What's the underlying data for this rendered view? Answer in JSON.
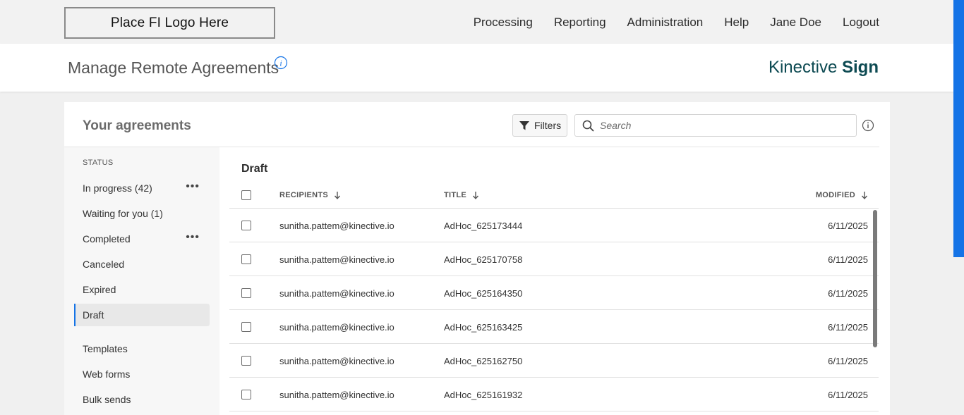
{
  "topbar": {
    "logo_text": "Place FI Logo Here",
    "nav": [
      "Processing",
      "Reporting",
      "Administration",
      "Help",
      "Jane Doe",
      "Logout"
    ]
  },
  "header": {
    "title": "Manage Remote Agreements",
    "brand_light": "Kinective",
    "brand_bold": "Sign"
  },
  "card": {
    "title": "Your agreements",
    "filters_label": "Filters",
    "search_placeholder": "Search"
  },
  "sidebar": {
    "status_heading": "STATUS",
    "items": [
      {
        "label": "In progress (42)",
        "has_menu": true
      },
      {
        "label": "Waiting for you (1)",
        "has_menu": false
      },
      {
        "label": "Completed",
        "has_menu": true
      },
      {
        "label": "Canceled",
        "has_menu": false
      },
      {
        "label": "Expired",
        "has_menu": false
      },
      {
        "label": "Draft",
        "has_menu": false,
        "active": true
      },
      {
        "label": "Templates",
        "has_menu": false
      },
      {
        "label": "Web forms",
        "has_menu": false
      },
      {
        "label": "Bulk sends",
        "has_menu": false
      }
    ]
  },
  "table": {
    "section_title": "Draft",
    "columns": {
      "recipients": "RECIPIENTS",
      "title": "TITLE",
      "modified": "MODIFIED"
    },
    "rows": [
      {
        "recipient": "sunitha.pattem@kinective.io",
        "title": "AdHoc_625173444",
        "modified": "6/11/2025"
      },
      {
        "recipient": "sunitha.pattem@kinective.io",
        "title": "AdHoc_625170758",
        "modified": "6/11/2025"
      },
      {
        "recipient": "sunitha.pattem@kinective.io",
        "title": "AdHoc_625164350",
        "modified": "6/11/2025"
      },
      {
        "recipient": "sunitha.pattem@kinective.io",
        "title": "AdHoc_625163425",
        "modified": "6/11/2025"
      },
      {
        "recipient": "sunitha.pattem@kinective.io",
        "title": "AdHoc_625162750",
        "modified": "6/11/2025"
      },
      {
        "recipient": "sunitha.pattem@kinective.io",
        "title": "AdHoc_625161932",
        "modified": "6/11/2025"
      }
    ]
  },
  "colors": {
    "accent": "#1473e6",
    "brand": "#0d4a52"
  },
  "icons": [
    "info-icon",
    "filter-icon",
    "search-icon",
    "sort-down-arrow-icon",
    "more-options-icon"
  ]
}
